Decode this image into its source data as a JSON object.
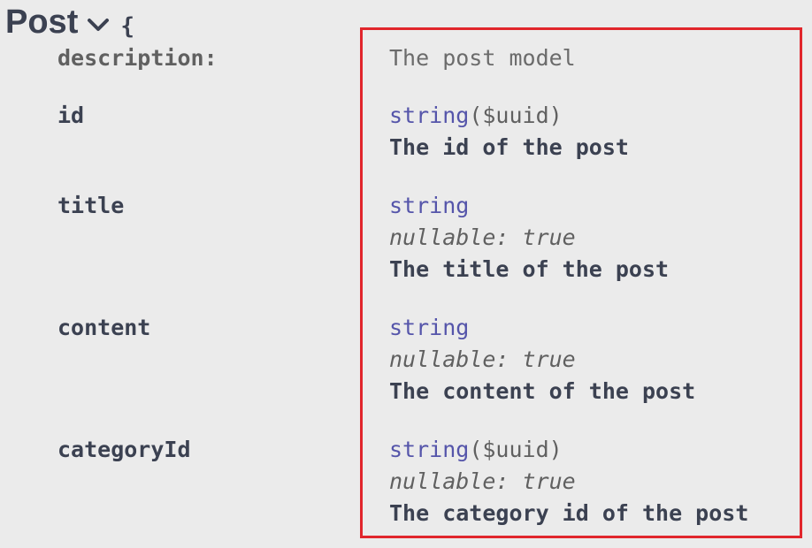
{
  "model": {
    "name": "Post",
    "brace": "{"
  },
  "description": {
    "label": "description:",
    "value": "The post model"
  },
  "properties": [
    {
      "name": "id",
      "type": "string",
      "format": "($uuid)",
      "nullable": "",
      "description": "The id of the post"
    },
    {
      "name": "title",
      "type": "string",
      "format": "",
      "nullable": "nullable: true",
      "description": "The title of the post"
    },
    {
      "name": "content",
      "type": "string",
      "format": "",
      "nullable": "nullable: true",
      "description": "The content of the post"
    },
    {
      "name": "categoryId",
      "type": "string",
      "format": "($uuid)",
      "nullable": "nullable: true",
      "description": "The category id of the post"
    }
  ],
  "colors": {
    "highlight_border": "#e1262c",
    "type_color": "#5555aa",
    "background": "#ebebeb"
  },
  "icons": {
    "toggle": "chevron-down-icon"
  }
}
